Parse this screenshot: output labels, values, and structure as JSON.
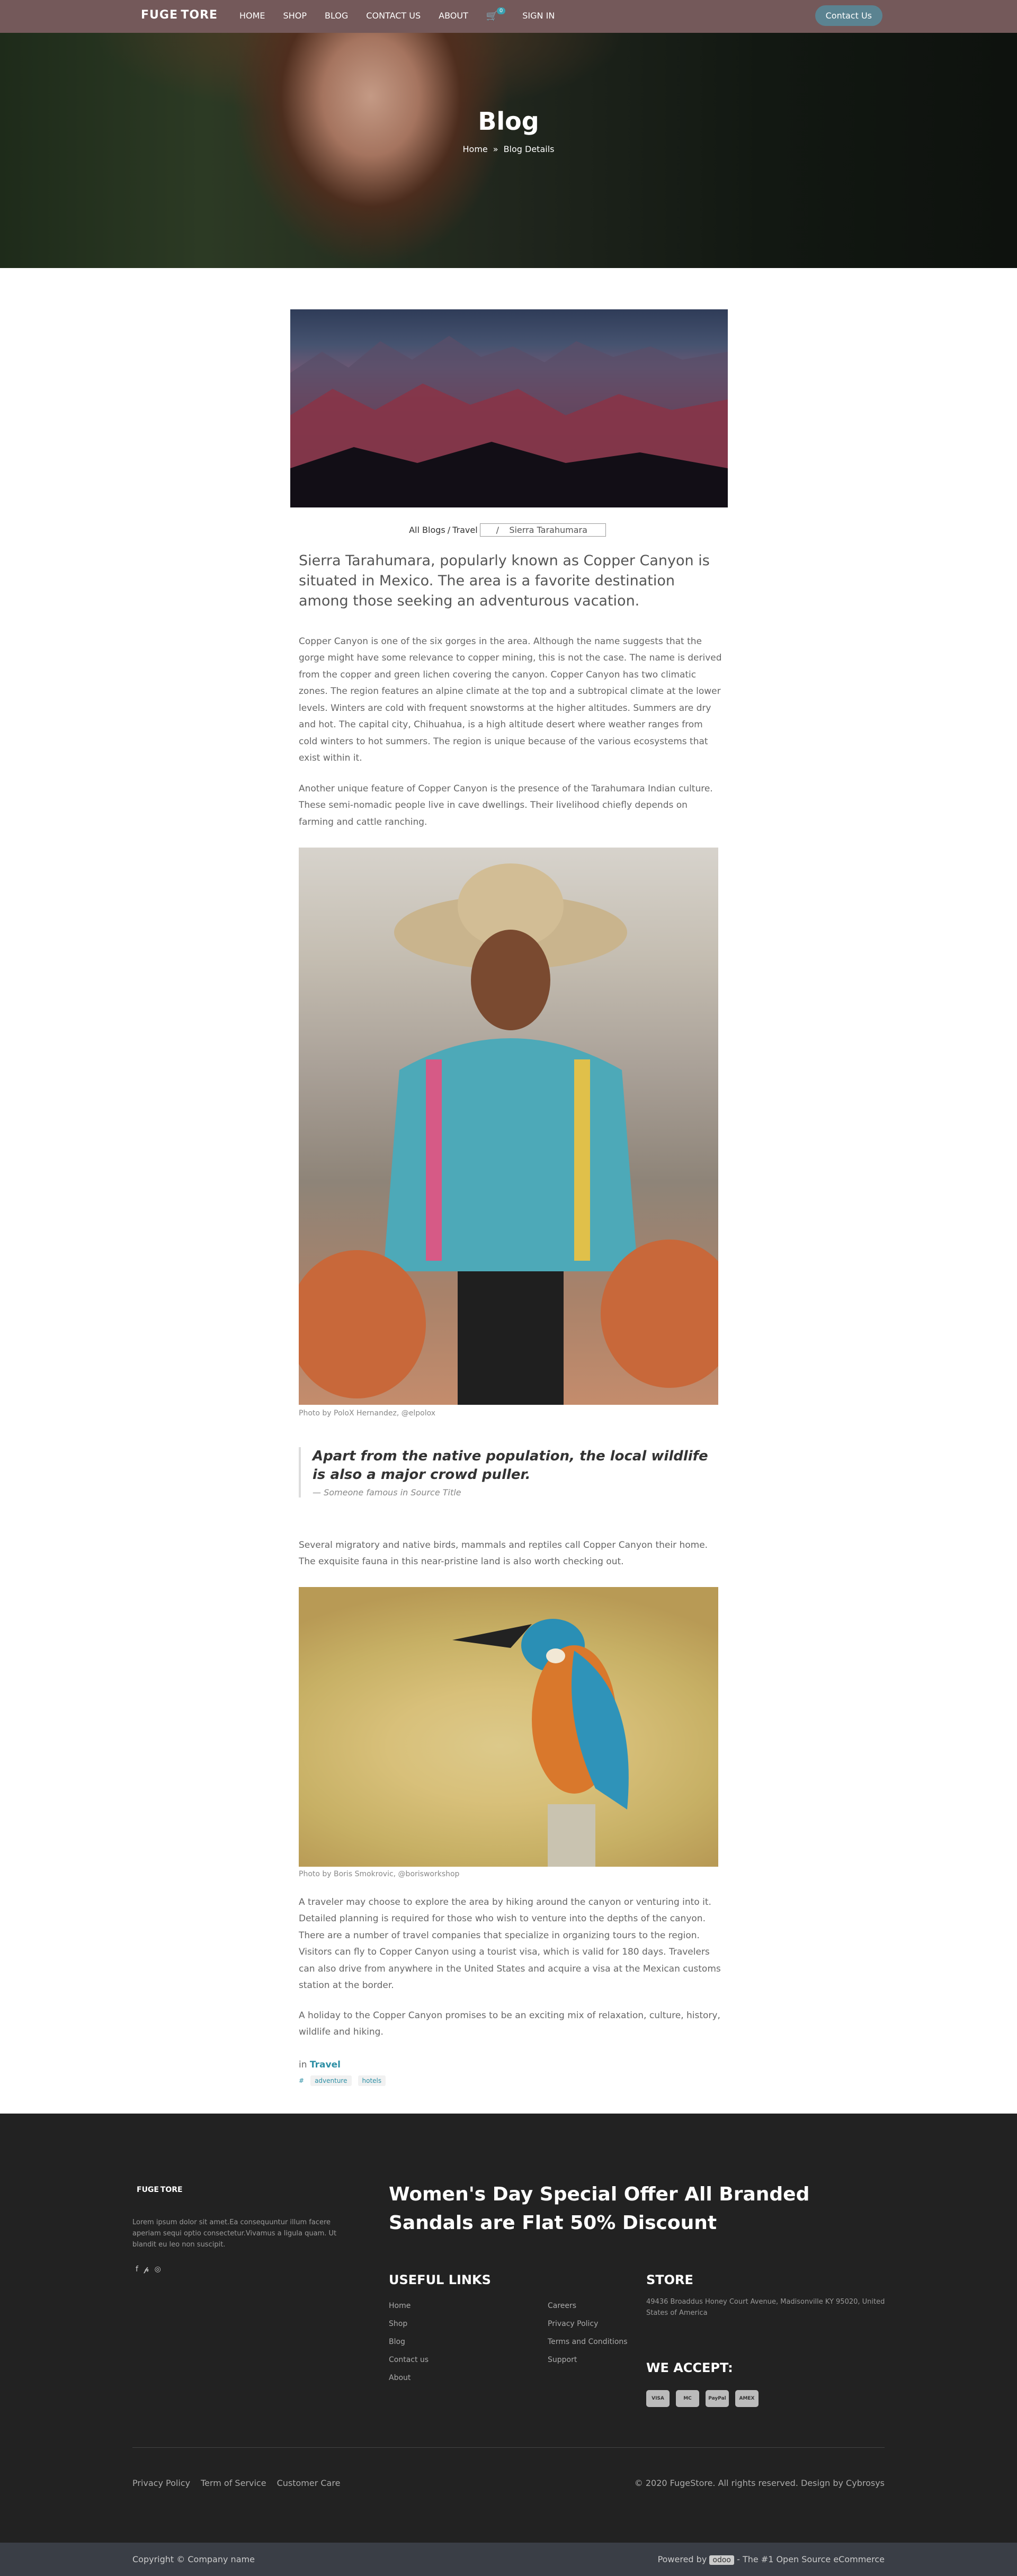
{
  "nav": {
    "logo": "FUGE TORE",
    "links": [
      "HOME",
      "SHOP",
      "BLOG",
      "CONTACT US",
      "ABOUT"
    ],
    "cart_count": "0",
    "signin": "SIGN IN",
    "contact_button": "Contact Us"
  },
  "hero": {
    "title": "Blog",
    "crumb_home": "Home",
    "crumb_current": "Blog Details"
  },
  "breadcrumb": {
    "all_blogs": "All Blogs",
    "category": "Travel",
    "current": "Sierra Tarahumara"
  },
  "article": {
    "lead": "Sierra Tarahumara, popularly known as Copper Canyon is situated in Mexico. The area is a favorite destination among those seeking an adventurous vacation.",
    "p1": "Copper Canyon is one of the six gorges in the area. Although the name suggests that the gorge might have some relevance to copper mining, this is not the case. The name is derived from the copper and green lichen covering the canyon. Copper Canyon has two climatic zones. The region features an alpine climate at the top and a subtropical climate at the lower levels. Winters are cold with frequent snowstorms at the higher altitudes. Summers are dry and hot. The capital city, Chihuahua, is a high altitude desert where weather ranges from cold winters to hot summers. The region is unique because of the various ecosystems that exist within it.",
    "p2": "Another unique feature of Copper Canyon is the presence of the Tarahumara Indian culture. These semi-nomadic people live in cave dwellings. Their livelihood chiefly depends on farming and cattle ranching.",
    "caption1": "Photo by PoloX Hernandez, @elpolox",
    "quote": "Apart from the native population, the local wildlife is also a major crowd puller.",
    "quote_source": "— Someone famous in Source Title",
    "p3": "Several migratory and native birds, mammals and reptiles call Copper Canyon their home. The exquisite fauna in this near-pristine land is also worth checking out.",
    "caption2": "Photo by Boris Smokrovic, @borisworkshop",
    "p4": "A traveler may choose to explore the area by hiking around the canyon or venturing into it. Detailed planning is required for those who wish to venture into the depths of the canyon. There are a number of travel companies that specialize in organizing tours to the region. Visitors can fly to Copper Canyon using a tourist visa, which is valid for 180 days. Travelers can also drive from anywhere in the United States and acquire a visa at the Mexican customs station at the border.",
    "p5": "A holiday to the Copper Canyon promises to be an exciting mix of relaxation, culture, history, wildlife and hiking.",
    "in_label": "in",
    "category": "Travel",
    "tags": [
      "adventure",
      "hotels"
    ]
  },
  "footer": {
    "logo": "FUGE TORE",
    "about": "Lorem ipsum dolor sit amet.Ea consequuntur illum facere aperiam sequi optio consectetur.Vivamus a ligula quam. Ut blandit eu leo non suscipit.",
    "offer": "Women's Day Special Offer All Branded Sandals are Flat 50% Discount",
    "useful_title": "USEFUL LINKS",
    "useful_col1": [
      "Home",
      "Shop",
      "Blog",
      "Contact us",
      "About"
    ],
    "useful_col2": [
      "Careers",
      "Privacy Policy",
      "Terms and Conditions",
      "Support"
    ],
    "store_title": "STORE",
    "address": "49436 Broaddus Honey Court Avenue, Madisonville KY 95020, United States of America",
    "accept_title": "WE ACCEPT:",
    "cards": [
      "VISA",
      "MC",
      "PayPal",
      "AMEX"
    ],
    "bottom_links": [
      "Privacy Policy",
      "Term of Service",
      "Customer Care"
    ],
    "copyright": "© 2020 FugeStore. All rights reserved. Design by Cybrosys"
  },
  "subfooter": {
    "left": "Copyright © Company name",
    "powered": "Powered by",
    "odoo": "odoo",
    "suffix": "- The #1 Open Source eCommerce"
  }
}
